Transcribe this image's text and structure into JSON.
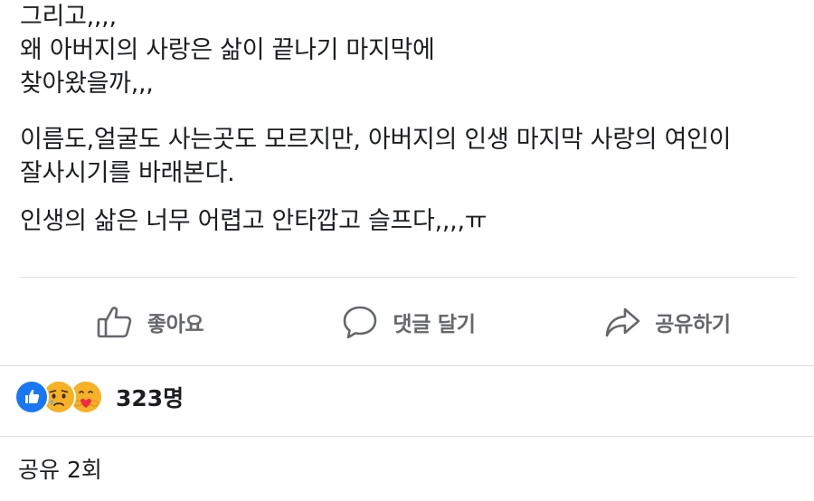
{
  "post": {
    "paragraphs": [
      {
        "lines": [
          "그리고,,,,",
          "왜 아버지의 사랑은 삶이 끝나기 마지막에",
          "찾아왔을까,,,"
        ]
      },
      {
        "lines": [
          "이름도,얼굴도 사는곳도 모르지만, 아버지의 인생 마지막 사랑의 여인이",
          "잘사시기를 바래본다."
        ]
      },
      {
        "lines": [
          "인생의 삶은 너무 어렵고 안타깝고 슬프다,,,,ㅠ"
        ]
      }
    ]
  },
  "actions": {
    "like": {
      "label": "좋아요",
      "icon": "thumbs-up-icon"
    },
    "comment": {
      "label": "댓글 달기",
      "icon": "speech-bubble-icon"
    },
    "share": {
      "label": "공유하기",
      "icon": "share-arrow-icon"
    }
  },
  "reactions": {
    "icons": [
      "like-reaction-icon",
      "sad-reaction-icon",
      "care-reaction-icon"
    ],
    "count": "323명"
  },
  "shares": {
    "text": "공유 2회"
  },
  "colors": {
    "text": "#1c1e21",
    "secondary": "#65676b",
    "divider": "#dadde1",
    "like_blue": "#1877f2",
    "emoji_yellow": "#f7b125"
  }
}
